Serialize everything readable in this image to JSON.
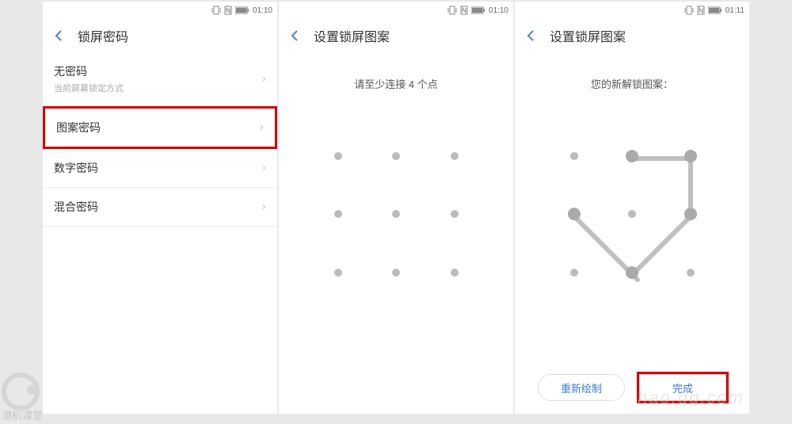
{
  "statusbar": {
    "time1": "01:10",
    "time2": "01:10",
    "time3": "01:11"
  },
  "screen1": {
    "title": "锁屏密码",
    "items": [
      {
        "label": "无密码",
        "sub": "当前屏幕锁定方式"
      },
      {
        "label": "图案密码"
      },
      {
        "label": "数字密码"
      },
      {
        "label": "混合密码"
      }
    ]
  },
  "screen2": {
    "title": "设置锁屏图案",
    "instruction": "请至少连接 4 个点"
  },
  "screen3": {
    "title": "设置锁屏图案",
    "instruction": "您的新解锁图案：",
    "btn_redo": "重新绘制",
    "btn_done": "完成"
  },
  "watermark": "潮机课堂",
  "watermark_right": "hao.qq.com"
}
